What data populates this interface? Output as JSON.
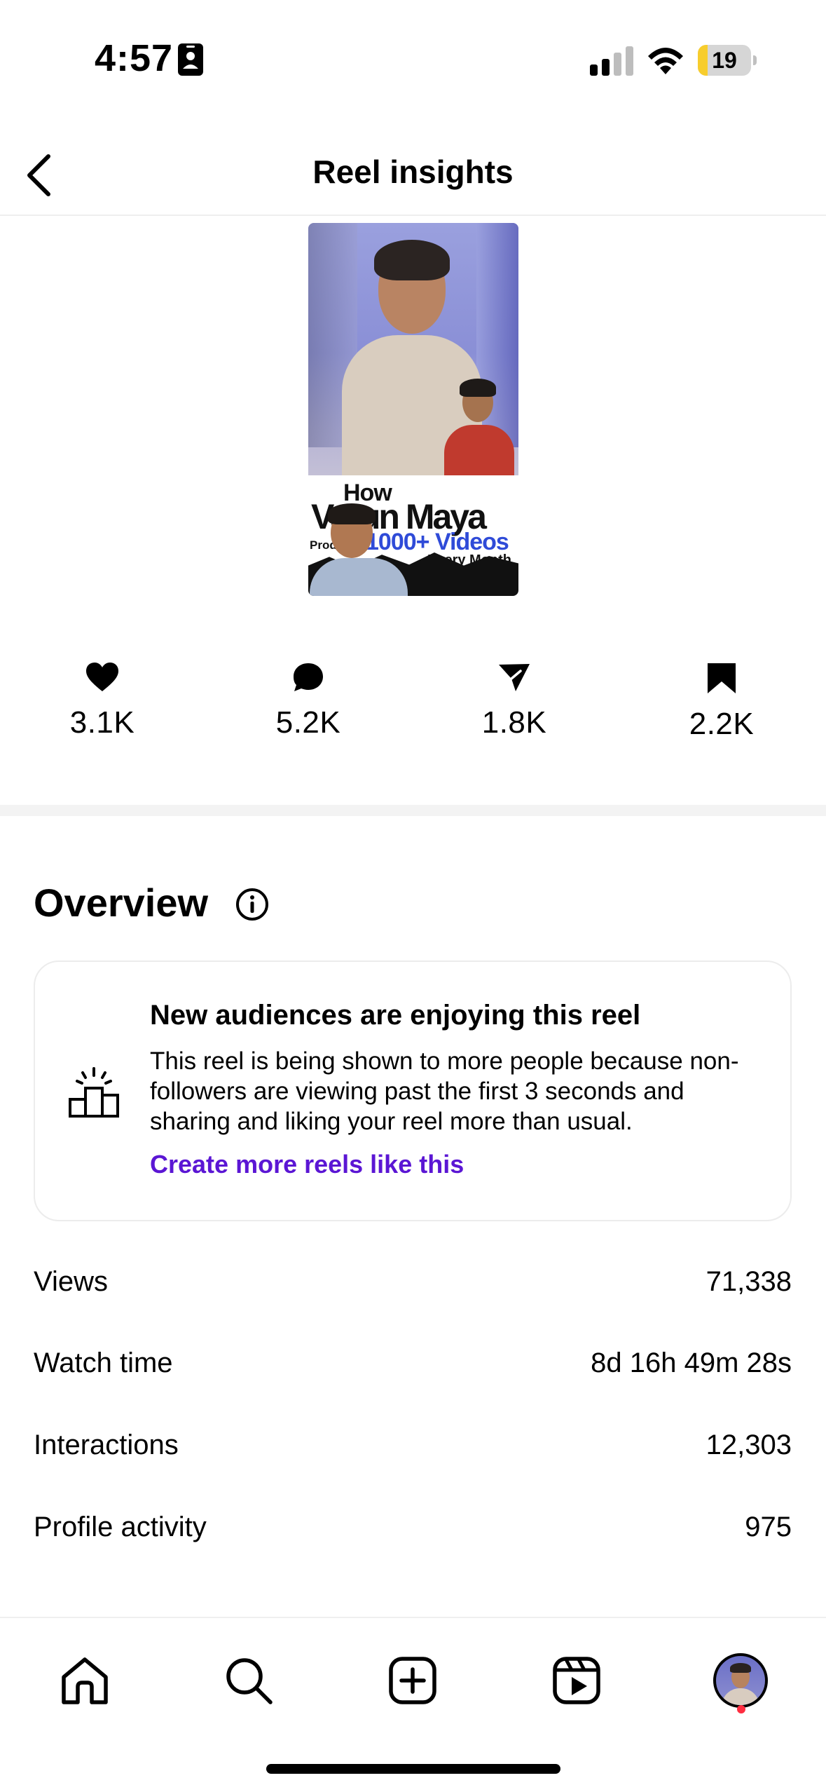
{
  "status_bar": {
    "time": "4:57",
    "battery": "19",
    "battery_level": 0.19,
    "icons": [
      "contact-card-icon",
      "signal-icon",
      "wifi-icon",
      "battery-icon"
    ]
  },
  "header": {
    "title": "Reel insights",
    "back_icon": "chevron-left-icon"
  },
  "thumbnail": {
    "line1": "How",
    "line2": "Varun Maya",
    "line3a": "Produces",
    "line3b": "1000+ Videos",
    "line4": "Every Month"
  },
  "stats": [
    {
      "icon": "heart-icon",
      "value": "3.1K"
    },
    {
      "icon": "comment-icon",
      "value": "5.2K"
    },
    {
      "icon": "share-icon",
      "value": "1.8K"
    },
    {
      "icon": "bookmark-icon",
      "value": "2.2K"
    }
  ],
  "overview": {
    "title": "Overview",
    "info_icon": "info-icon",
    "card": {
      "title": "New audiences are enjoying this reel",
      "body": "This reel is being shown to more people because non-followers are viewing past the first 3 seconds and sharing and liking your reel more than usual.",
      "link": "Create more reels like this",
      "link_color": "#5b16d4"
    },
    "metrics": [
      {
        "label": "Views",
        "value": "71,338"
      },
      {
        "label": "Watch time",
        "value": "8d 16h 49m 28s"
      },
      {
        "label": "Interactions",
        "value": "12,303"
      },
      {
        "label": "Profile activity",
        "value": "975"
      }
    ]
  },
  "bottom_nav": {
    "items": [
      "home-icon",
      "search-icon",
      "create-icon",
      "reels-icon",
      "profile-avatar"
    ]
  }
}
